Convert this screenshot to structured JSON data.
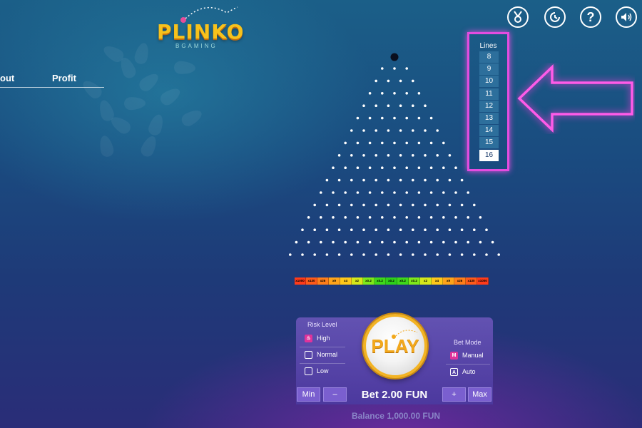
{
  "logo": {
    "title": "PLINKO",
    "subtitle": "BGAMING"
  },
  "top_icons": [
    "medal-icon",
    "history-icon",
    "help-icon",
    "sound-icon"
  ],
  "top_icon_glyphs": [
    "🏅",
    "⟳",
    "?",
    "◀)"
  ],
  "history": {
    "col1": "out",
    "col2": "Profit"
  },
  "lines": {
    "title": "Lines",
    "options": [
      "8",
      "9",
      "10",
      "11",
      "12",
      "13",
      "14",
      "15",
      "16"
    ],
    "selected": "16"
  },
  "board": {
    "rows": 16
  },
  "multipliers": [
    "x1000",
    "x130",
    "x26",
    "x9",
    "x4",
    "x2",
    "x0.2",
    "x0.2",
    "x0.2",
    "x0.2",
    "x0.2",
    "x2",
    "x4",
    "x9",
    "x26",
    "x130",
    "x1000"
  ],
  "multiplier_colors": [
    "#ff3b1a",
    "#ff5a1a",
    "#ff7e1a",
    "#ffa41a",
    "#ffc81a",
    "#d6e81a",
    "#7fe81a",
    "#3fd81a",
    "#2ecf1a",
    "#3fd81a",
    "#7fe81a",
    "#d6e81a",
    "#ffc81a",
    "#ffa41a",
    "#ff7e1a",
    "#ff5a1a",
    "#ff3b1a"
  ],
  "risk": {
    "title": "Risk Level",
    "options": [
      {
        "label": "High",
        "icon": "high-risk-icon",
        "selected": true
      },
      {
        "label": "Normal",
        "icon": "normal-risk-icon",
        "selected": false
      },
      {
        "label": "Low",
        "icon": "low-risk-icon",
        "selected": false
      }
    ]
  },
  "play": {
    "label": "PLAY"
  },
  "bet_mode": {
    "title": "Bet Mode",
    "options": [
      {
        "label": "Manual",
        "badge": "M",
        "selected": true
      },
      {
        "label": "Auto",
        "badge": "A",
        "selected": false
      }
    ]
  },
  "bet": {
    "min": "Min",
    "minus": "–",
    "text": "Bet 2.00 FUN",
    "plus": "+",
    "max": "Max"
  },
  "balance": "Balance 1,000.00 FUN",
  "colors": {
    "accent": "#e44ce0",
    "play_gold": "#f3b323",
    "panel": "#5a48b0"
  }
}
